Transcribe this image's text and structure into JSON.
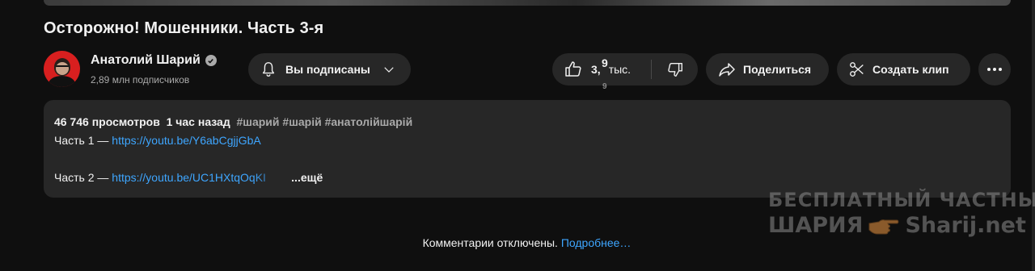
{
  "video": {
    "title": "Осторожно! Мошенники. Часть 3-я"
  },
  "channel": {
    "name": "Анатолий Шарий",
    "subscribers": "2,89 млн подписчиков"
  },
  "actions": {
    "subscribed_label": "Вы подписаны",
    "like_count_top": "9",
    "like_count_main": "3,",
    "like_count_unit": "тыс.",
    "like_count_bottom": "9",
    "share_label": "Поделиться",
    "clip_label": "Создать клип"
  },
  "description": {
    "views": "46 746 просмотров",
    "time": "1 час назад",
    "tags": "#шарий #шарій #анатолійшарій",
    "part1_label": "Часть 1 —",
    "part1_link": "https://youtu.be/Y6abCgjjGbA",
    "part2_label": "Часть 2 —",
    "part2_link": "https://youtu.be/UC1HXtqOqKI",
    "more": "...ещё"
  },
  "comments": {
    "disabled_text": "Комментарии отключены.",
    "learn_more": "Подробнее…"
  },
  "watermark": {
    "line1": "БЕСПЛАТНЫЙ ЧАСТНЫЙ",
    "line2_left": "ШАРИЯ",
    "line2_right": "Sharij.net"
  },
  "icons": [
    "bell-icon",
    "chevron-down-icon",
    "thumb-up-icon",
    "thumb-down-icon",
    "share-arrow-icon",
    "scissors-icon",
    "more-horiz-icon",
    "verified-check-icon",
    "pointing-hand-icon"
  ],
  "colors": {
    "background": "#0f0f0f",
    "pill": "#272727",
    "link": "#3ea6ff",
    "avatar": "#d81f1f"
  }
}
